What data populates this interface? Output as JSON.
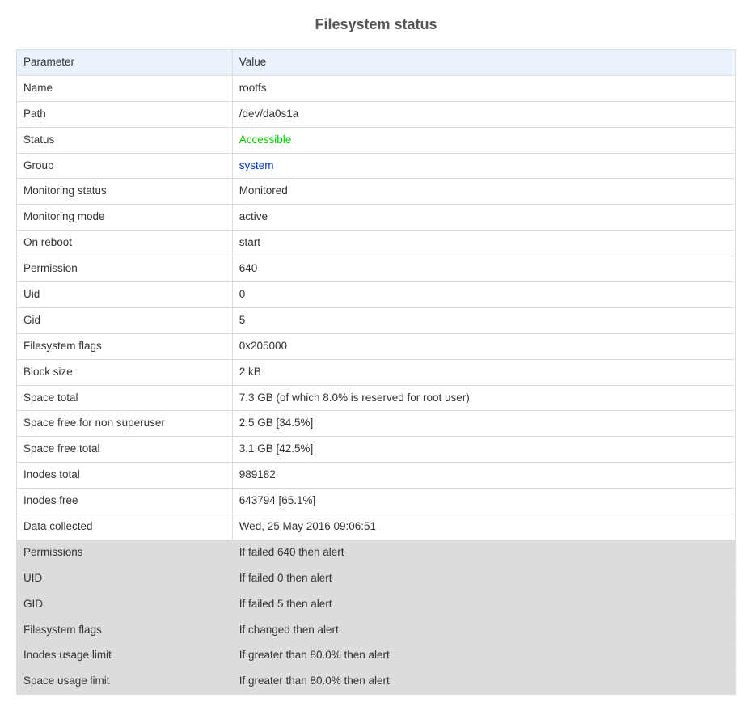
{
  "title": "Filesystem status",
  "headers": {
    "param": "Parameter",
    "value": "Value"
  },
  "rows": [
    {
      "param": "Name",
      "value": "rootfs",
      "type": "plain"
    },
    {
      "param": "Path",
      "value": "/dev/da0s1a",
      "type": "plain"
    },
    {
      "param": "Status",
      "value": "Accessible",
      "type": "status"
    },
    {
      "param": "Group",
      "value": "system",
      "type": "link"
    },
    {
      "param": "Monitoring status",
      "value": "Monitored",
      "type": "plain"
    },
    {
      "param": "Monitoring mode",
      "value": "active",
      "type": "plain"
    },
    {
      "param": "On reboot",
      "value": "start",
      "type": "plain"
    },
    {
      "param": "Permission",
      "value": "640",
      "type": "plain"
    },
    {
      "param": "Uid",
      "value": "0",
      "type": "plain"
    },
    {
      "param": "Gid",
      "value": "5",
      "type": "plain"
    },
    {
      "param": "Filesystem flags",
      "value": "0x205000",
      "type": "plain"
    },
    {
      "param": "Block size",
      "value": "2 kB",
      "type": "plain"
    },
    {
      "param": "Space total",
      "value": "7.3 GB (of which 8.0% is reserved for root user)",
      "type": "plain"
    },
    {
      "param": "Space free for non superuser",
      "value": "2.5 GB [34.5%]",
      "type": "plain"
    },
    {
      "param": "Space free total",
      "value": "3.1 GB [42.5%]",
      "type": "plain"
    },
    {
      "param": "Inodes total",
      "value": "989182",
      "type": "plain"
    },
    {
      "param": "Inodes free",
      "value": "643794 [65.1%]",
      "type": "plain"
    },
    {
      "param": "Data collected",
      "value": "Wed, 25 May 2016 09:06:51",
      "type": "plain"
    },
    {
      "param": "Permissions",
      "value": "If failed 640 then alert",
      "type": "alert"
    },
    {
      "param": "UID",
      "value": "If failed 0 then alert",
      "type": "alert"
    },
    {
      "param": "GID",
      "value": "If failed 5 then alert",
      "type": "alert"
    },
    {
      "param": "Filesystem flags",
      "value": "If changed then alert",
      "type": "alert"
    },
    {
      "param": "Inodes usage limit",
      "value": "If greater than 80.0% then alert",
      "type": "alert"
    },
    {
      "param": "Space usage limit",
      "value": "If greater than 80.0% then alert",
      "type": "alert"
    }
  ]
}
